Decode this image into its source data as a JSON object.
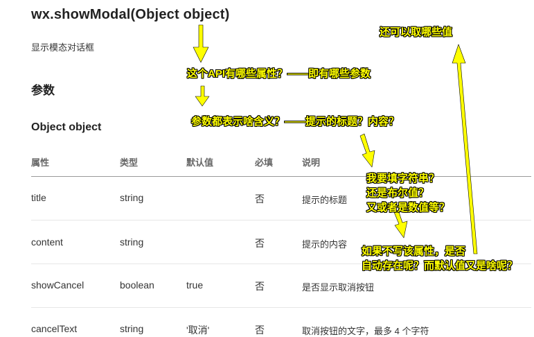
{
  "doc": {
    "title": "wx.showModal(Object object)",
    "subtitle": "显示模态对话框",
    "params_heading": "参数",
    "object_heading": "Object object"
  },
  "table": {
    "headers": [
      "属性",
      "类型",
      "默认值",
      "必填",
      "说明"
    ],
    "rows": [
      [
        "title",
        "string",
        "",
        "否",
        "提示的标题"
      ],
      [
        "content",
        "string",
        "",
        "否",
        "提示的内容"
      ],
      [
        "showCancel",
        "boolean",
        "true",
        "否",
        "是否显示取消按钮"
      ],
      [
        "cancelText",
        "string",
        "'取消'",
        "否",
        "取消按钮的文字，最多 4 个字符"
      ]
    ]
  },
  "annotations": {
    "color": "#ffff00",
    "n1": "这个API有哪些属性？——即有哪些参数",
    "n2": "参数都表示啥含义？——提示的标题？内容？",
    "n3": [
      "我要填字符串？",
      "还是布尔值？",
      "又或者是数值等？"
    ],
    "n4": [
      "如果不写该属性，是否",
      "自动存在呢？而默认值又是啥呢？"
    ],
    "n5": "还可以取哪些值"
  }
}
